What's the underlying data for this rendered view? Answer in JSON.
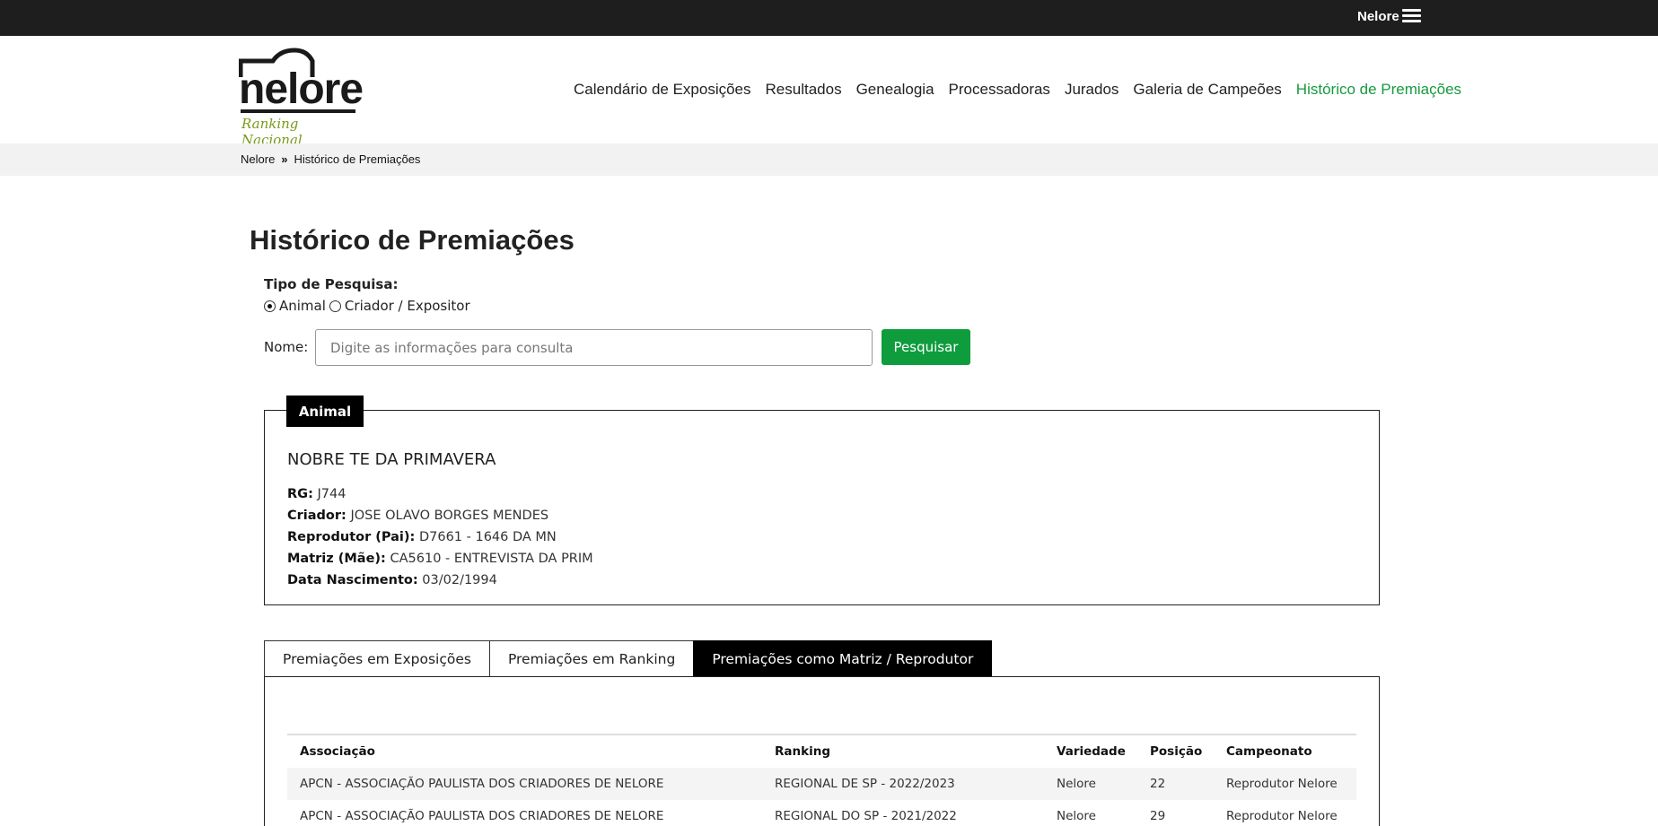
{
  "topbar": {
    "brand": "Nelore",
    "menu_icon": "hamburger-menu-icon"
  },
  "header": {
    "logo": {
      "word": "nelore",
      "subtitle": "Ranking Nacional"
    },
    "nav": [
      {
        "label": "Calendário de Exposições",
        "active": false
      },
      {
        "label": "Resultados",
        "active": false
      },
      {
        "label": "Genealogia",
        "active": false
      },
      {
        "label": "Processadoras",
        "active": false
      },
      {
        "label": "Jurados",
        "active": false
      },
      {
        "label": "Galeria de Campeões",
        "active": false
      },
      {
        "label": "Histórico de Premiações",
        "active": true
      }
    ]
  },
  "breadcrumb": {
    "home": "Nelore",
    "current": "Histórico de Premiações"
  },
  "page_title": "Histórico de Premiações",
  "search": {
    "type_label": "Tipo de Pesquisa:",
    "options": [
      {
        "label": "Animal",
        "selected": true
      },
      {
        "label": "Criador / Expositor",
        "selected": false
      }
    ],
    "name_label": "Nome:",
    "placeholder": "Digite as informações para consulta",
    "value": "",
    "button_label": "Pesquisar"
  },
  "animal": {
    "legend": "Animal",
    "name": "NOBRE TE DA PRIMAVERA",
    "fields": [
      {
        "label": "RG:",
        "value": "J744"
      },
      {
        "label": "Criador:",
        "value": "JOSE OLAVO BORGES MENDES"
      },
      {
        "label": "Reprodutor (Pai):",
        "value": "D7661 - 1646 DA MN"
      },
      {
        "label": "Matriz (Mãe):",
        "value": "CA5610 - ENTREVISTA DA PRIM"
      },
      {
        "label": "Data Nascimento:",
        "value": "03/02/1994"
      }
    ]
  },
  "tabs": [
    {
      "label": "Premiações em Exposições",
      "active": false
    },
    {
      "label": "Premiações em Ranking",
      "active": false
    },
    {
      "label": "Premiações como Matriz / Reprodutor",
      "active": true
    }
  ],
  "table": {
    "headers": [
      "Associação",
      "Ranking",
      "Variedade",
      "Posição",
      "Campeonato"
    ],
    "rows": [
      [
        "APCN - ASSOCIAÇÃO PAULISTA DOS CRIADORES DE NELORE",
        "REGIONAL DE SP - 2022/2023",
        "Nelore",
        "22",
        "Reprodutor Nelore"
      ],
      [
        "APCN - ASSOCIAÇÃO PAULISTA DOS CRIADORES DE NELORE",
        "REGIONAL DO SP - 2021/2022",
        "Nelore",
        "29",
        "Reprodutor Nelore"
      ]
    ]
  },
  "colors": {
    "accent_green": "#169a3f",
    "button_green": "#0e9c3d",
    "topbar": "#1e1e1e"
  }
}
